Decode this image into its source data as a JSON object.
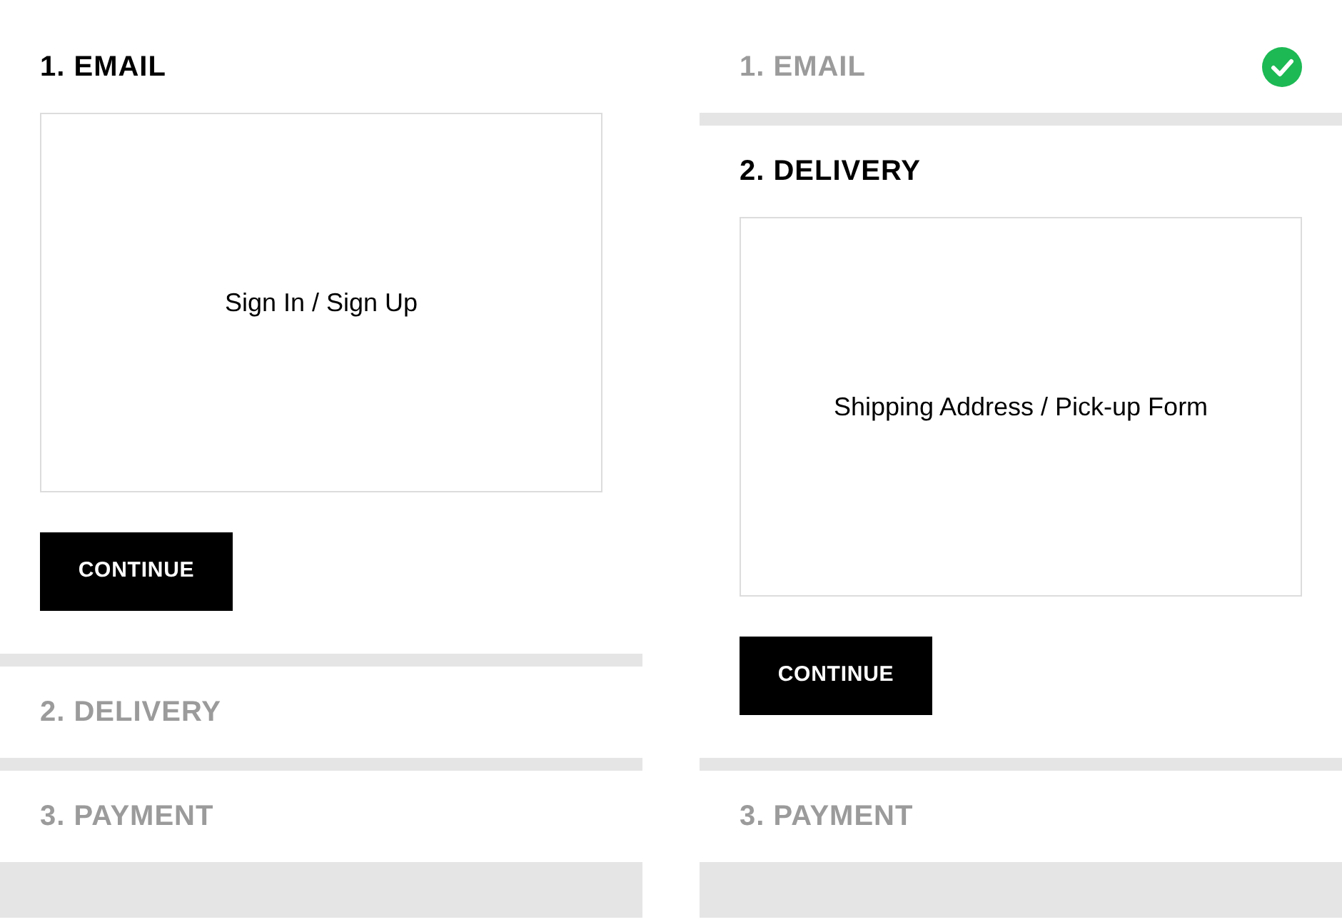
{
  "panels": [
    {
      "steps": [
        {
          "title": "1. EMAIL",
          "kind": "active",
          "content": "Sign In / Sign Up",
          "button": "CONTINUE"
        },
        {
          "title": "2. DELIVERY",
          "kind": "pending"
        },
        {
          "title": "3. PAYMENT",
          "kind": "pending"
        }
      ]
    },
    {
      "steps": [
        {
          "title": "1. EMAIL",
          "kind": "done"
        },
        {
          "title": "2. DELIVERY",
          "kind": "active",
          "content": "Shipping Address / Pick-up Form",
          "button": "CONTINUE"
        },
        {
          "title": "3. PAYMENT",
          "kind": "pending"
        }
      ]
    }
  ]
}
